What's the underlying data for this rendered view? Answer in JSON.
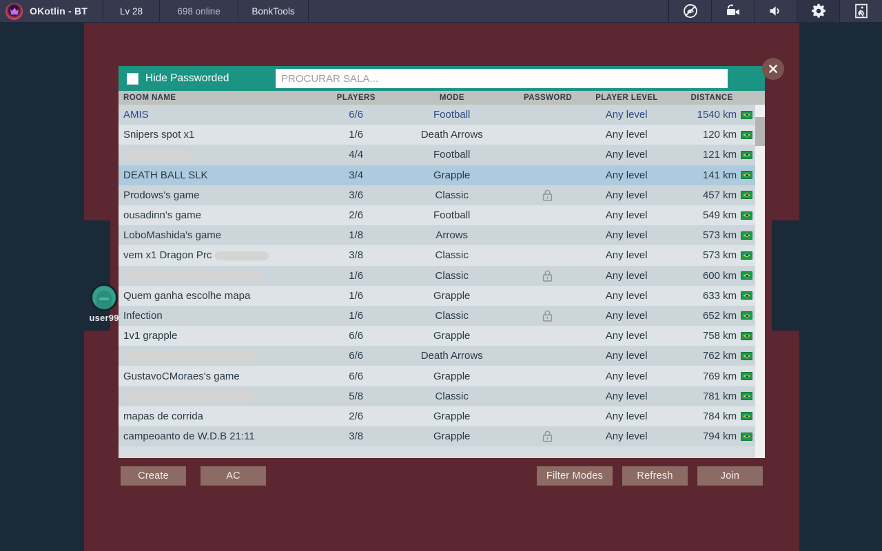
{
  "topbar": {
    "logo_icon": "crown-logo-icon",
    "title": "OKotlin - BT",
    "level": "Lv 28",
    "online": "698 online",
    "tool": "BonkTools",
    "icons": [
      {
        "name": "eye-off-icon",
        "label": ""
      },
      {
        "name": "video-camera-icon",
        "label": ""
      },
      {
        "name": "volume-icon",
        "label": ""
      },
      {
        "name": "gear-icon",
        "label": ""
      },
      {
        "name": "exit-door-icon",
        "label": ""
      }
    ]
  },
  "player": {
    "name": "user99",
    "avatar_icon": "player-avatar-icon"
  },
  "dialog": {
    "hide_passworded_label": "Hide Passworded",
    "hide_passworded_checked": false,
    "search_placeholder": "PROCURAR SALA...",
    "search_value": "",
    "close_icon": "close-icon",
    "columns": [
      "ROOM NAME",
      "PLAYERS",
      "MODE",
      "PASSWORD",
      "PLAYER LEVEL",
      "DISTANCE"
    ],
    "rows": [
      {
        "name": "AMIS",
        "redacted": false,
        "players": "6/6",
        "mode": "Football",
        "locked": false,
        "level": "Any level",
        "distance": "1540 km",
        "flag": "br-flag-icon",
        "selected": false,
        "highlight": true
      },
      {
        "name": "Snipers spot x1",
        "redacted": false,
        "players": "1/6",
        "mode": "Death Arrows",
        "locked": false,
        "level": "Any level",
        "distance": "120 km",
        "flag": "br-flag-icon",
        "selected": false,
        "highlight": false
      },
      {
        "name": "",
        "redacted": true,
        "redact_width": 100,
        "players": "4/4",
        "mode": "Football",
        "locked": false,
        "level": "Any level",
        "distance": "121 km",
        "flag": "br-flag-icon",
        "selected": false,
        "highlight": false
      },
      {
        "name": "DEATH BALL SLK",
        "redacted": false,
        "players": "3/4",
        "mode": "Grapple",
        "locked": false,
        "level": "Any level",
        "distance": "141 km",
        "flag": "br-flag-icon",
        "selected": true,
        "highlight": false
      },
      {
        "name": "Prodows's game",
        "redacted": false,
        "players": "3/6",
        "mode": "Classic",
        "locked": true,
        "level": "Any level",
        "distance": "457 km",
        "flag": "br-flag-icon",
        "selected": false,
        "highlight": false
      },
      {
        "name": "ousadinn's game",
        "redacted": false,
        "players": "2/6",
        "mode": "Football",
        "locked": false,
        "level": "Any level",
        "distance": "549 km",
        "flag": "br-flag-icon",
        "selected": false,
        "highlight": false
      },
      {
        "name": "LoboMashida's game",
        "redacted": false,
        "players": "1/8",
        "mode": "Arrows",
        "locked": false,
        "level": "Any level",
        "distance": "573 km",
        "flag": "br-flag-icon",
        "selected": false,
        "highlight": false
      },
      {
        "name": "vem x1 Dragon Prc",
        "redacted": true,
        "redact_width": 78,
        "redact_after": true,
        "players": "3/8",
        "mode": "Classic",
        "locked": false,
        "level": "Any level",
        "distance": "573 km",
        "flag": "br-flag-icon",
        "selected": false,
        "highlight": false
      },
      {
        "name": "",
        "redacted": true,
        "redact_width": 200,
        "players": "1/6",
        "mode": "Classic",
        "locked": true,
        "level": "Any level",
        "distance": "600 km",
        "flag": "br-flag-icon",
        "selected": false,
        "highlight": false
      },
      {
        "name": "Quem ganha escolhe mapa",
        "redacted": false,
        "players": "1/6",
        "mode": "Grapple",
        "locked": false,
        "level": "Any level",
        "distance": "633 km",
        "flag": "br-flag-icon",
        "selected": false,
        "highlight": false
      },
      {
        "name": "Infection",
        "redacted": false,
        "players": "1/6",
        "mode": "Classic",
        "locked": true,
        "level": "Any level",
        "distance": "652 km",
        "flag": "br-flag-icon",
        "selected": false,
        "highlight": false
      },
      {
        "name": "1v1 grapple",
        "redacted": false,
        "players": "6/6",
        "mode": "Grapple",
        "locked": false,
        "level": "Any level",
        "distance": "758 km",
        "flag": "br-flag-icon",
        "selected": false,
        "highlight": false
      },
      {
        "name": "",
        "redacted": true,
        "redact_width": 195,
        "players": "6/6",
        "mode": "Death Arrows",
        "locked": false,
        "level": "Any level",
        "distance": "762 km",
        "flag": "br-flag-icon",
        "selected": false,
        "highlight": false
      },
      {
        "name": "GustavoCMoraes's game",
        "redacted": false,
        "players": "6/6",
        "mode": "Grapple",
        "locked": false,
        "level": "Any level",
        "distance": "769 km",
        "flag": "br-flag-icon",
        "selected": false,
        "highlight": false
      },
      {
        "name": "",
        "redacted": true,
        "redact_width": 188,
        "players": "5/8",
        "mode": "Classic",
        "locked": false,
        "level": "Any level",
        "distance": "781 km",
        "flag": "br-flag-icon",
        "selected": false,
        "highlight": false
      },
      {
        "name": "mapas de corrida",
        "redacted": false,
        "players": "2/6",
        "mode": "Grapple",
        "locked": false,
        "level": "Any level",
        "distance": "784 km",
        "flag": "br-flag-icon",
        "selected": false,
        "highlight": false
      },
      {
        "name": "campeoanto de W.D.B 21:11",
        "redacted": false,
        "players": "3/8",
        "mode": "Grapple",
        "locked": true,
        "level": "Any level",
        "distance": "794 km",
        "flag": "br-flag-icon",
        "selected": false,
        "highlight": false
      }
    ],
    "buttons": {
      "create": "Create",
      "ac": "AC",
      "filter_modes": "Filter Modes",
      "refresh": "Refresh",
      "join": "Join"
    }
  },
  "colors": {
    "arena": "#5c2730",
    "navy": "#1b2a38",
    "teal": "#1b9484",
    "topbar": "#363a4f",
    "button": "#8b6b63",
    "selected_row": "#aecade",
    "link_blue": "#2c4a86"
  }
}
